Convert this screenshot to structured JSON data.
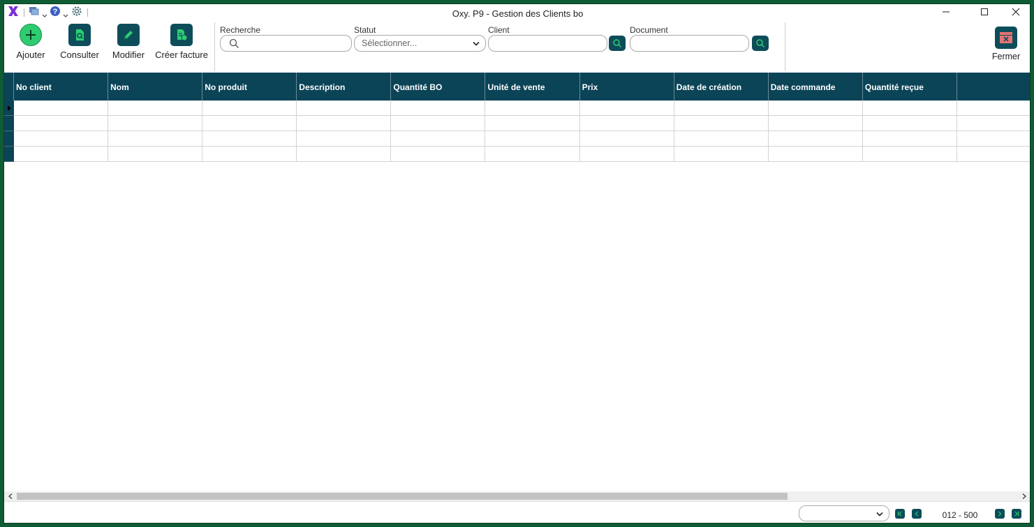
{
  "window": {
    "title": "Oxy. P9 - Gestion des Clients bo"
  },
  "colors": {
    "header_bg": "#0b4457",
    "button_bg": "#0d4d5a",
    "add_green": "#2ecc71",
    "logo_purple": "#7b2fd6",
    "frame_green": "#0f5c34"
  },
  "toolbar": {
    "buttons": [
      {
        "label": "Ajouter",
        "icon": "plus-circle-icon"
      },
      {
        "label": "Consulter",
        "icon": "document-search-icon"
      },
      {
        "label": "Modifier",
        "icon": "pencil-icon"
      },
      {
        "label": "Créer facture",
        "icon": "invoice-icon"
      }
    ],
    "close": {
      "label": "Fermer",
      "icon": "close-folder-icon"
    }
  },
  "filters": {
    "search": {
      "label": "Recherche",
      "value": ""
    },
    "status": {
      "label": "Statut",
      "placeholder": "Sélectionner..."
    },
    "client": {
      "label": "Client",
      "value": ""
    },
    "document": {
      "label": "Document",
      "value": ""
    }
  },
  "grid": {
    "columns": [
      "No client",
      "Nom",
      "No produit",
      "Description",
      "Quantité BO",
      "Unité de vente",
      "Prix",
      "Date de création",
      "Date commande",
      "Quantité reçue",
      ""
    ],
    "rows": [
      [
        "",
        "",
        "",
        "",
        "",
        "",
        "",
        "",
        "",
        "",
        ""
      ],
      [
        "",
        "",
        "",
        "",
        "",
        "",
        "",
        "",
        "",
        "",
        ""
      ],
      [
        "",
        "",
        "",
        "",
        "",
        "",
        "",
        "",
        "",
        "",
        ""
      ],
      [
        "",
        "",
        "",
        "",
        "",
        "",
        "",
        "",
        "",
        "",
        ""
      ]
    ]
  },
  "footer": {
    "page_size": "",
    "range": "012 - 500"
  }
}
